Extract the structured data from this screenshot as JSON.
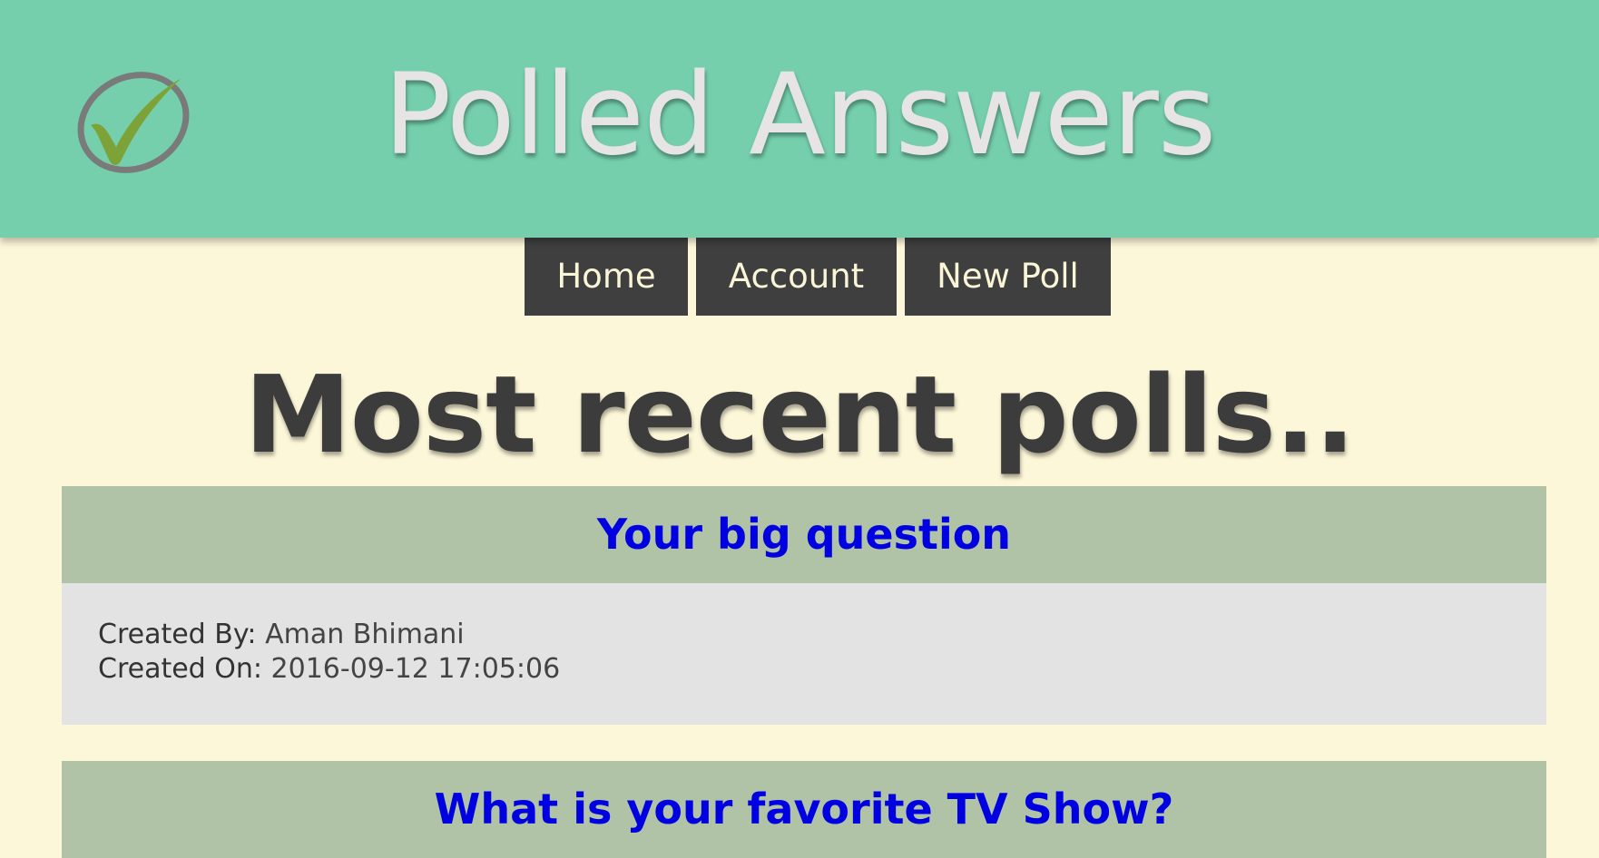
{
  "header": {
    "title": "Polled Answers",
    "logo_icon": "checkmark-circle-icon",
    "background_color": "#75cfad"
  },
  "nav": {
    "items": [
      {
        "label": "Home"
      },
      {
        "label": "Account"
      },
      {
        "label": "New Poll"
      }
    ]
  },
  "main": {
    "title": "Most recent polls..",
    "polls": [
      {
        "question": "Your big question",
        "created_by_label": "Created By:",
        "created_by": "Aman Bhimani",
        "created_on_label": "Created On:",
        "created_on": "2016-09-12 17:05:06"
      },
      {
        "question": "What is your favorite TV Show?"
      }
    ]
  },
  "colors": {
    "page_background": "#fdf7d9",
    "nav_background": "#3f3f3f",
    "poll_header": "#b0c3a7",
    "poll_body": "#e3e3e3",
    "link": "#0000e0"
  }
}
